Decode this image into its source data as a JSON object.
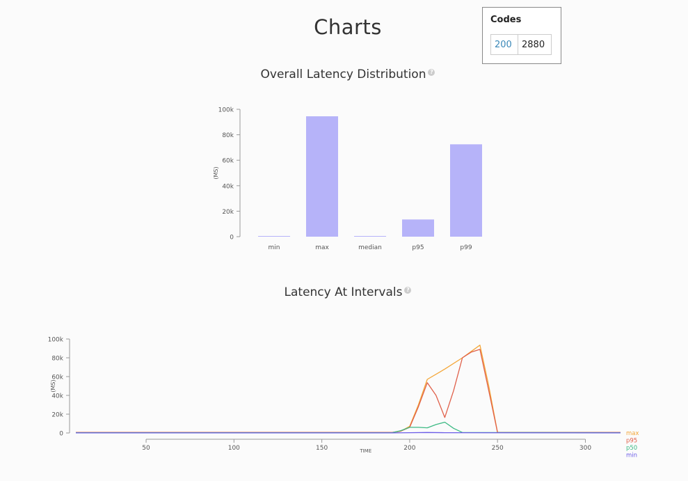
{
  "page": {
    "title": "Charts"
  },
  "codes": {
    "title": "Codes",
    "rows": [
      {
        "code": "200",
        "count": "2880"
      }
    ]
  },
  "colors": {
    "bar": "#b6b3f9",
    "max": "#f4a637",
    "p95": "#e0604a",
    "p50": "#3dba84",
    "min": "#6b5ce7",
    "axis": "#999999",
    "help_icon": "#cccccc"
  },
  "sections": {
    "distribution_title": "Overall Latency Distribution",
    "intervals_title": "Latency At Intervals"
  },
  "chart_data": [
    {
      "type": "bar",
      "title": "Overall Latency Distribution",
      "ylabel": "(MS)",
      "xlabel": "",
      "categories": [
        "min",
        "max",
        "median",
        "p95",
        "p99"
      ],
      "values": [
        100,
        94500,
        300,
        13500,
        72500
      ],
      "ylim": [
        0,
        100000
      ],
      "yticks": [
        0,
        20000,
        40000,
        60000,
        80000,
        100000
      ],
      "ytick_labels": [
        "0",
        "20k",
        "40k",
        "60k",
        "80k",
        "100k"
      ],
      "grid": false
    },
    {
      "type": "line",
      "title": "Latency At Intervals",
      "xlabel": "TIME",
      "ylabel": "(MS)",
      "xlim": [
        10,
        320
      ],
      "ylim": [
        0,
        100000
      ],
      "xticks": [
        50,
        100,
        150,
        200,
        250,
        300
      ],
      "yticks": [
        0,
        20000,
        40000,
        60000,
        80000,
        100000
      ],
      "ytick_labels": [
        "0",
        "20k",
        "40k",
        "60k",
        "80k",
        "100k"
      ],
      "legend_position": "bottom-right",
      "grid": false,
      "series": [
        {
          "name": "max",
          "x": [
            10,
            190,
            195,
            200,
            205,
            210,
            220,
            230,
            240,
            245,
            250,
            255,
            320
          ],
          "y": [
            500,
            500,
            2000,
            7000,
            30000,
            57000,
            68000,
            80000,
            93500,
            50000,
            500,
            500,
            500
          ]
        },
        {
          "name": "p95",
          "x": [
            10,
            190,
            195,
            200,
            205,
            210,
            215,
            220,
            225,
            230,
            235,
            240,
            245,
            250,
            255,
            320
          ],
          "y": [
            500,
            500,
            2000,
            6000,
            28000,
            53500,
            40000,
            16500,
            45000,
            80000,
            86000,
            89000,
            45000,
            500,
            500,
            500
          ]
        },
        {
          "name": "p50",
          "x": [
            10,
            190,
            195,
            200,
            205,
            210,
            215,
            220,
            225,
            230,
            320
          ],
          "y": [
            300,
            300,
            2500,
            6000,
            6000,
            5500,
            9000,
            11500,
            5000,
            500,
            300
          ]
        },
        {
          "name": "min",
          "x": [
            10,
            190,
            200,
            210,
            220,
            320
          ],
          "y": [
            100,
            100,
            300,
            500,
            300,
            100
          ]
        }
      ]
    }
  ]
}
